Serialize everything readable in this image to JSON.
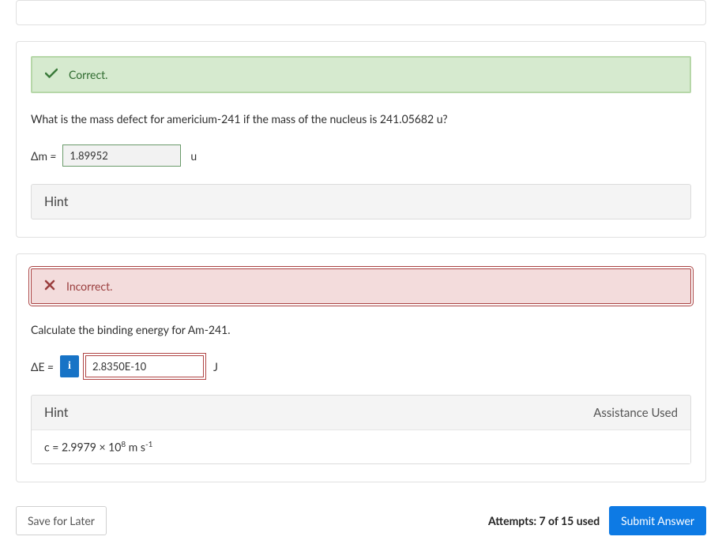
{
  "part1": {
    "status_label": "Correct.",
    "question": "What is the mass defect for americium-241 if the mass of the nucleus is 241.05682 u?",
    "prefix_symbol": "Δm",
    "equals": " = ",
    "value": "1.89952",
    "unit": "u",
    "hint_label": "Hint"
  },
  "part2": {
    "status_label": "Incorrect.",
    "question": "Calculate the binding energy for Am-241.",
    "prefix_symbol": "ΔE",
    "equals": " = ",
    "info_icon": "i",
    "value": "2.8350E-10",
    "unit": "J",
    "hint_label": "Hint",
    "assistance_label": "Assistance Used",
    "hint_body_prefix": "c = 2.9979 × 10",
    "hint_body_exp": "8",
    "hint_body_suffix": " m s",
    "hint_body_exp2": "-1"
  },
  "footer": {
    "save_label": "Save for Later",
    "attempts_label": "Attempts: 7 of 15 used",
    "submit_label": "Submit Answer"
  }
}
